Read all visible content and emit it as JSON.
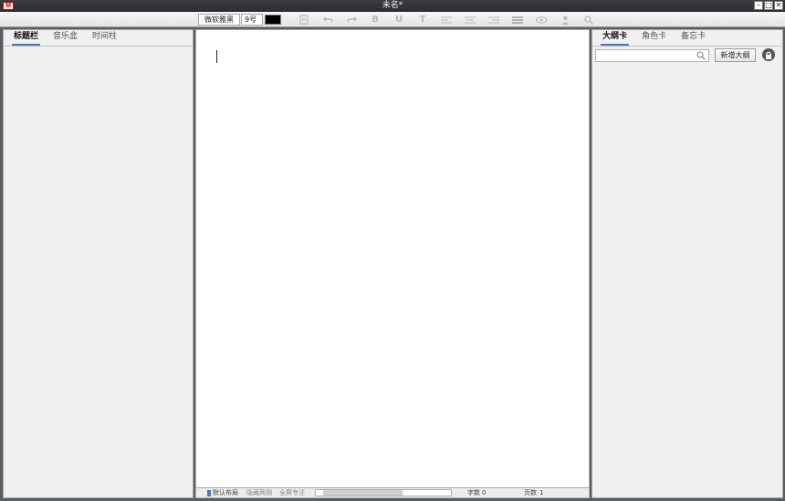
{
  "window": {
    "title": "未名*",
    "logo": "M",
    "buttons": [
      "minimize",
      "maximize",
      "close"
    ]
  },
  "toolbar": {
    "font_name": "微软雅黑",
    "font_size": "9号",
    "text_color": "#000000",
    "tools": [
      {
        "name": "save-icon",
        "glyph": ""
      },
      {
        "name": "undo-icon",
        "glyph": "↶"
      },
      {
        "name": "redo-icon",
        "glyph": "↷"
      },
      {
        "name": "bold-icon",
        "glyph": "B"
      },
      {
        "name": "underline-icon",
        "glyph": "U"
      },
      {
        "name": "text-icon",
        "glyph": "T"
      },
      {
        "name": "align-left-icon",
        "glyph": ""
      },
      {
        "name": "align-center-icon",
        "glyph": ""
      },
      {
        "name": "align-right-icon",
        "glyph": ""
      },
      {
        "name": "align-justify-icon",
        "glyph": ""
      },
      {
        "name": "eye-icon",
        "glyph": ""
      },
      {
        "name": "person-icon",
        "glyph": ""
      },
      {
        "name": "search-icon",
        "glyph": ""
      }
    ]
  },
  "left_panel": {
    "tabs": [
      {
        "label": "标题栏",
        "active": true
      },
      {
        "label": "音乐盒",
        "active": false
      },
      {
        "label": "时间柱",
        "active": false
      }
    ]
  },
  "right_panel": {
    "tabs": [
      {
        "label": "大纲卡",
        "active": true
      },
      {
        "label": "角色卡",
        "active": false
      },
      {
        "label": "备忘卡",
        "active": false
      }
    ],
    "search_value": "",
    "add_button_label": "新增大纲"
  },
  "statusbar": {
    "layout_default": "默认布局",
    "layout_hide": "隐藏两侧",
    "layout_full": "全屏专注",
    "progress": 0.62,
    "word_count_label": "字数",
    "word_count": "0",
    "page_count_label": "页数",
    "page_count": "1"
  },
  "colors": {
    "accent": "#4a76c9",
    "titlebar": "#2f3237",
    "frame": "#5a5e63"
  }
}
